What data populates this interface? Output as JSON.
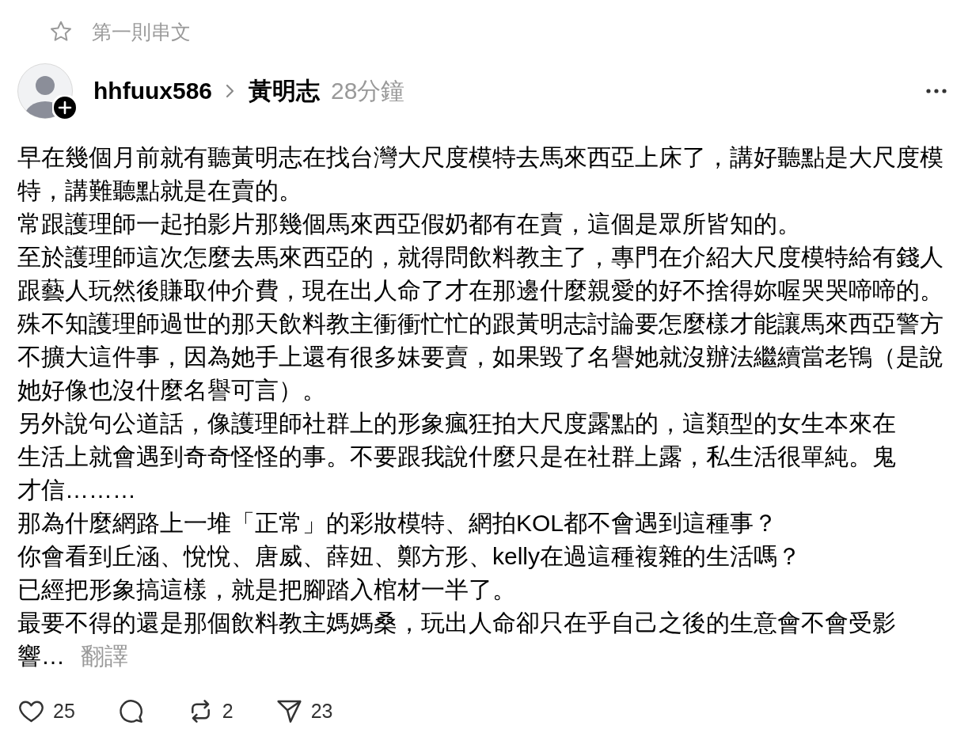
{
  "thread_label": {
    "text": "第一則串文"
  },
  "post": {
    "author": {
      "username": "hhfuux586",
      "reply_to": "黃明志",
      "time": "28分鐘"
    },
    "paragraphs": [
      {
        "lines": [
          "早在幾個月前就有聽黃明志在找台灣大尺度模特去馬來西亞上床了，講好聽點是大尺度模",
          "特，講難聽點就是在賣的。"
        ]
      },
      {
        "lines": [
          "常跟護理師一起拍影片那幾個馬來西亞假奶都有在賣，這個是眾所皆知的。"
        ]
      },
      {
        "lines": [
          "至於護理師這次怎麼去馬來西亞的，就得問飲料教主了，專門在介紹大尺度模特給有錢人",
          "跟藝人玩然後賺取仲介費，現在出人命了才在那邊什麼親愛的好不捨得妳喔哭哭啼啼的。"
        ]
      },
      {
        "lines": [
          "殊不知護理師過世的那天飲料教主衝衝忙忙的跟黃明志討論要怎麼樣才能讓馬來西亞警方",
          "不擴大這件事，因為她手上還有很多妹要賣，如果毀了名譽她就沒辦法繼續當老鴇（是說",
          "她好像也沒什麼名譽可言）。"
        ]
      },
      {
        "lines": [
          "另外說句公道話，像護理師社群上的形象瘋狂拍大尺度露點的，這類型的女生本來在",
          "生活上就會遇到奇奇怪怪的事。不要跟我說什麼只是在社群上露，私生活很單純。鬼",
          "才信………"
        ]
      },
      {
        "lines": [
          "那為什麼網路上一堆「正常」的彩妝模特、網拍KOL都不會遇到這種事？"
        ]
      },
      {
        "lines": [
          "你會看到丘涵、悅悅、唐威、薛妞、鄭方形、kelly在過這種複雜的生活嗎？"
        ]
      },
      {
        "lines": [
          "已經把形象搞這樣，就是把腳踏入棺材一半了。"
        ]
      },
      {
        "lines": [
          "最要不得的還是那個飲料教主媽媽桑，玩出人命卻只在乎自己之後的生意會不會受影",
          "響…"
        ]
      }
    ],
    "translate_link": "翻譯",
    "actions": [
      {
        "kind": "like",
        "count": "25"
      },
      {
        "kind": "comment"
      },
      {
        "kind": "repost",
        "count": "2"
      },
      {
        "kind": "share",
        "count": "23"
      }
    ]
  }
}
